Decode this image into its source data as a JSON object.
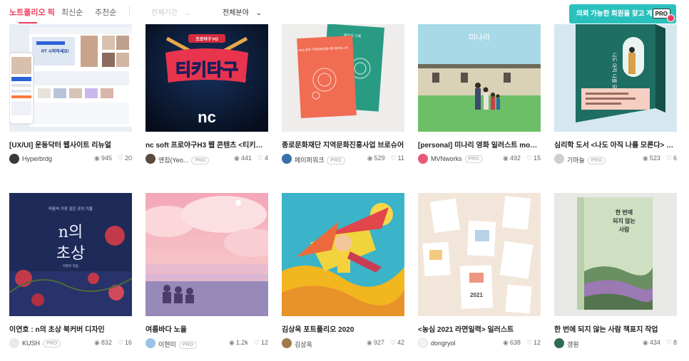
{
  "tabs": [
    {
      "label": "노트폴리오 픽",
      "active": true
    },
    {
      "label": "최신순",
      "active": false
    },
    {
      "label": "추천순",
      "active": false
    }
  ],
  "filters": {
    "period_label": "전체기간",
    "field_label": "전체분야"
  },
  "promo": {
    "text": "의뢰 가능한 회원을 찾고 계세요?",
    "pro_label": "PRO"
  },
  "icons": {
    "views": "eye-icon",
    "likes": "heart-icon",
    "chevron": "chevron-down-icon"
  },
  "colors": {
    "accent": "#ef3c5b",
    "promo": "#2ac1bd"
  },
  "cards": [
    {
      "title": "[UX/UI] 운동닥터 웹사이트 리뉴얼",
      "author": "Hyperbrdg",
      "pro": false,
      "views": "945",
      "likes": "20"
    },
    {
      "title": "nc soft 프로야구H3 웹 콘텐츠 <티키타구...",
      "author": "앤집(Yeo...",
      "pro": true,
      "views": "441",
      "likes": "4"
    },
    {
      "title": "종로문화재단 지역문화진흥사업 브로슈어",
      "author": "페이퍼워크",
      "pro": true,
      "views": "529",
      "likes": "11"
    },
    {
      "title": "[personal] 미나리 영화 일러스트 movie ...",
      "author": "MVNworks",
      "pro": true,
      "views": "492",
      "likes": "15"
    },
    {
      "title": "심리학 도서 <나도 아직 나를 모른다> 개...",
      "author": "기마늘",
      "pro": true,
      "views": "523",
      "likes": "6"
    },
    {
      "title": "이연호 : n의 초상 북커버 디자인",
      "author": "KUSH",
      "pro": true,
      "views": "832",
      "likes": "16"
    },
    {
      "title": "여름바다 노을",
      "author": "이현미",
      "pro": true,
      "views": "1.2k",
      "likes": "12"
    },
    {
      "title": "김상욱 포트폴리오 2020",
      "author": "김상욱",
      "pro": false,
      "views": "927",
      "likes": "42"
    },
    {
      "title": "<농심 2021 라면일력> 일러스트",
      "author": "dongryol",
      "pro": false,
      "views": "638",
      "likes": "12"
    },
    {
      "title": "한 번에 되지 않는 사람 책표지 작업",
      "author": "갱원",
      "pro": false,
      "views": "434",
      "likes": "8"
    }
  ],
  "artwork": {
    "card1": {
      "banner": "PT 시작하세요!"
    },
    "card2": {
      "pennant": "프로야구 H3",
      "title": "티키타구",
      "logo": "nc"
    },
    "card3": {
      "book_a": "2020 종로 지역문화진흥사업 결과보고서",
      "book_b": "종로의 기록"
    },
    "card4": {
      "title": "미나리"
    },
    "card5": {
      "title": "나도 아직 나를 모른다"
    },
    "card6": {
      "top": "마음속 가장 깊은 곳의 거울",
      "title_a": "n의",
      "title_b": "초상",
      "author": "이연호 지음"
    },
    "card8": {},
    "card9": {
      "year": "2021"
    },
    "card10": {
      "title_a": "한 번에",
      "title_b": "되지 않는",
      "title_c": "사람"
    }
  }
}
